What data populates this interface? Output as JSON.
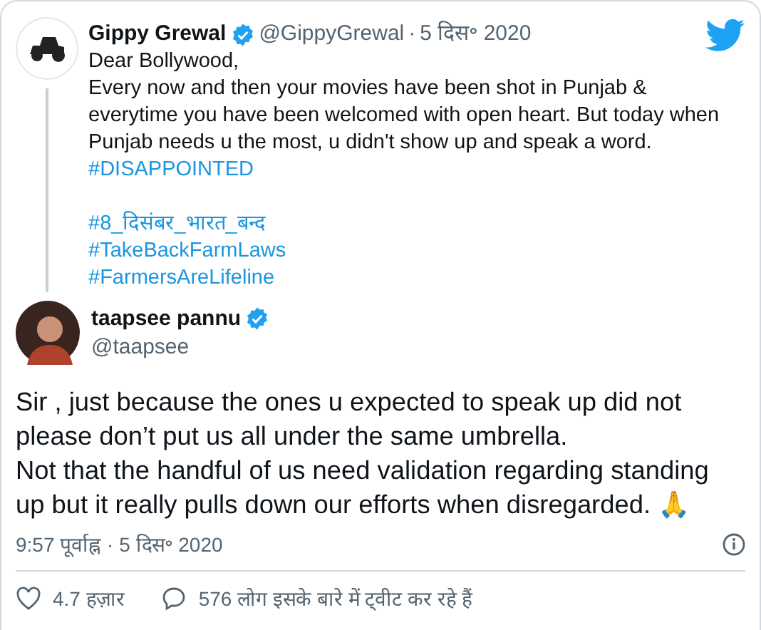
{
  "quoted_tweet": {
    "name": "Gippy Grewal",
    "verified": true,
    "handle": "@GippyGrewal",
    "separator": "·",
    "date": "5 दिस॰ 2020",
    "text": "Dear Bollywood,\nEvery now and then your movies have been shot in Punjab &\neverytime you have been welcomed with open heart. But today when\nPunjab needs u the most, u didn't show up and speak a word.",
    "hashtag_groups": [
      [
        "#DISAPPOINTED"
      ],
      [
        "#8_दिसंबर_भारत_बन्द",
        "#TakeBackFarmLaws",
        "#FarmersAreLifeline"
      ]
    ]
  },
  "tweet": {
    "name": "taapsee pannu",
    "verified": true,
    "handle": "@taapsee",
    "text": "Sir , just because the ones u expected to speak up did not\nplease don’t put us all under the same umbrella.\nNot that the handful of us need validation regarding standing\nup but it really pulls down our efforts when disregarded. 🙏",
    "timestamp": "9:57 पूर्वाह्न · 5 दिस॰ 2020",
    "likes": "4.7 हज़ार",
    "replies": "576 लोग इसके बारे में ट्वीट कर रहे हैं"
  }
}
